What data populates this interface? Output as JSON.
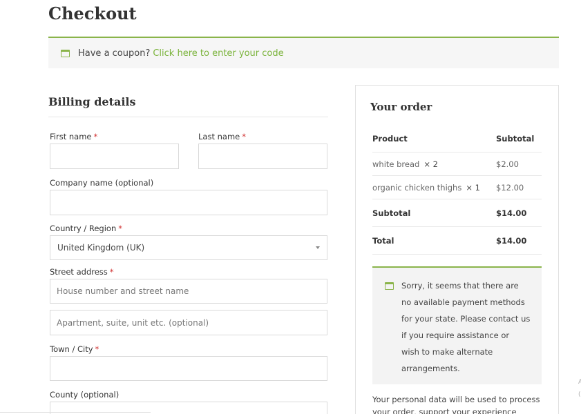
{
  "page": {
    "title": "Checkout"
  },
  "coupon": {
    "prompt": "Have a coupon?",
    "link": "Click here to enter your code"
  },
  "billing": {
    "title": "Billing details",
    "first_name_label": "First name",
    "last_name_label": "Last name",
    "company_label": "Company name (optional)",
    "country_label": "Country / Region",
    "country_value": "United Kingdom (UK)",
    "street_label": "Street address",
    "street_placeholder": "House number and street name",
    "apartment_placeholder": "Apartment, suite, unit etc. (optional)",
    "town_label": "Town / City",
    "county_label": "County (optional)",
    "required_mark": "*"
  },
  "order": {
    "title": "Your order",
    "header_product": "Product",
    "header_subtotal": "Subtotal",
    "items": [
      {
        "name": "white bread",
        "qty": "× 2",
        "price": "$2.00"
      },
      {
        "name": "organic chicken thighs",
        "qty": "× 1",
        "price": "$12.00"
      }
    ],
    "subtotal_label": "Subtotal",
    "subtotal_value": "$14.00",
    "total_label": "Total",
    "total_value": "$14.00"
  },
  "notice": {
    "lines": [
      "Sorry, it seems that there are",
      "no available payment methods",
      "for your state. Please contact us",
      "if you require assistance or",
      "wish to make alternate",
      "arrangements."
    ]
  },
  "privacy": {
    "lines": [
      "Your personal data will be used to process",
      "your order, support your experience"
    ]
  },
  "edge": {
    "glyph1": "A",
    "glyph2": "("
  },
  "colors": {
    "accent": "#8ab44a",
    "link": "#7ab33a",
    "required": "#d13030"
  }
}
